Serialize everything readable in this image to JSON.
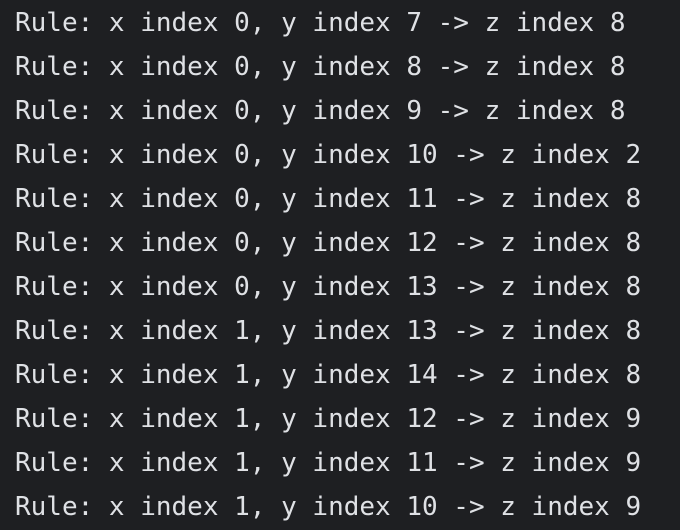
{
  "console": {
    "lines": [
      "Rule: x index 0, y index 7 -> z index 8",
      "Rule: x index 0, y index 8 -> z index 8",
      "Rule: x index 0, y index 9 -> z index 8",
      "Rule: x index 0, y index 10 -> z index 2",
      "Rule: x index 0, y index 11 -> z index 8",
      "Rule: x index 0, y index 12 -> z index 8",
      "Rule: x index 0, y index 13 -> z index 8",
      "Rule: x index 1, y index 13 -> z index 8",
      "Rule: x index 1, y index 14 -> z index 8",
      "Rule: x index 1, y index 12 -> z index 9",
      "Rule: x index 1, y index 11 -> z index 9",
      "Rule: x index 1, y index 10 -> z index 9"
    ]
  },
  "colors": {
    "background": "#1e1f22",
    "text": "#dfe1e5"
  }
}
